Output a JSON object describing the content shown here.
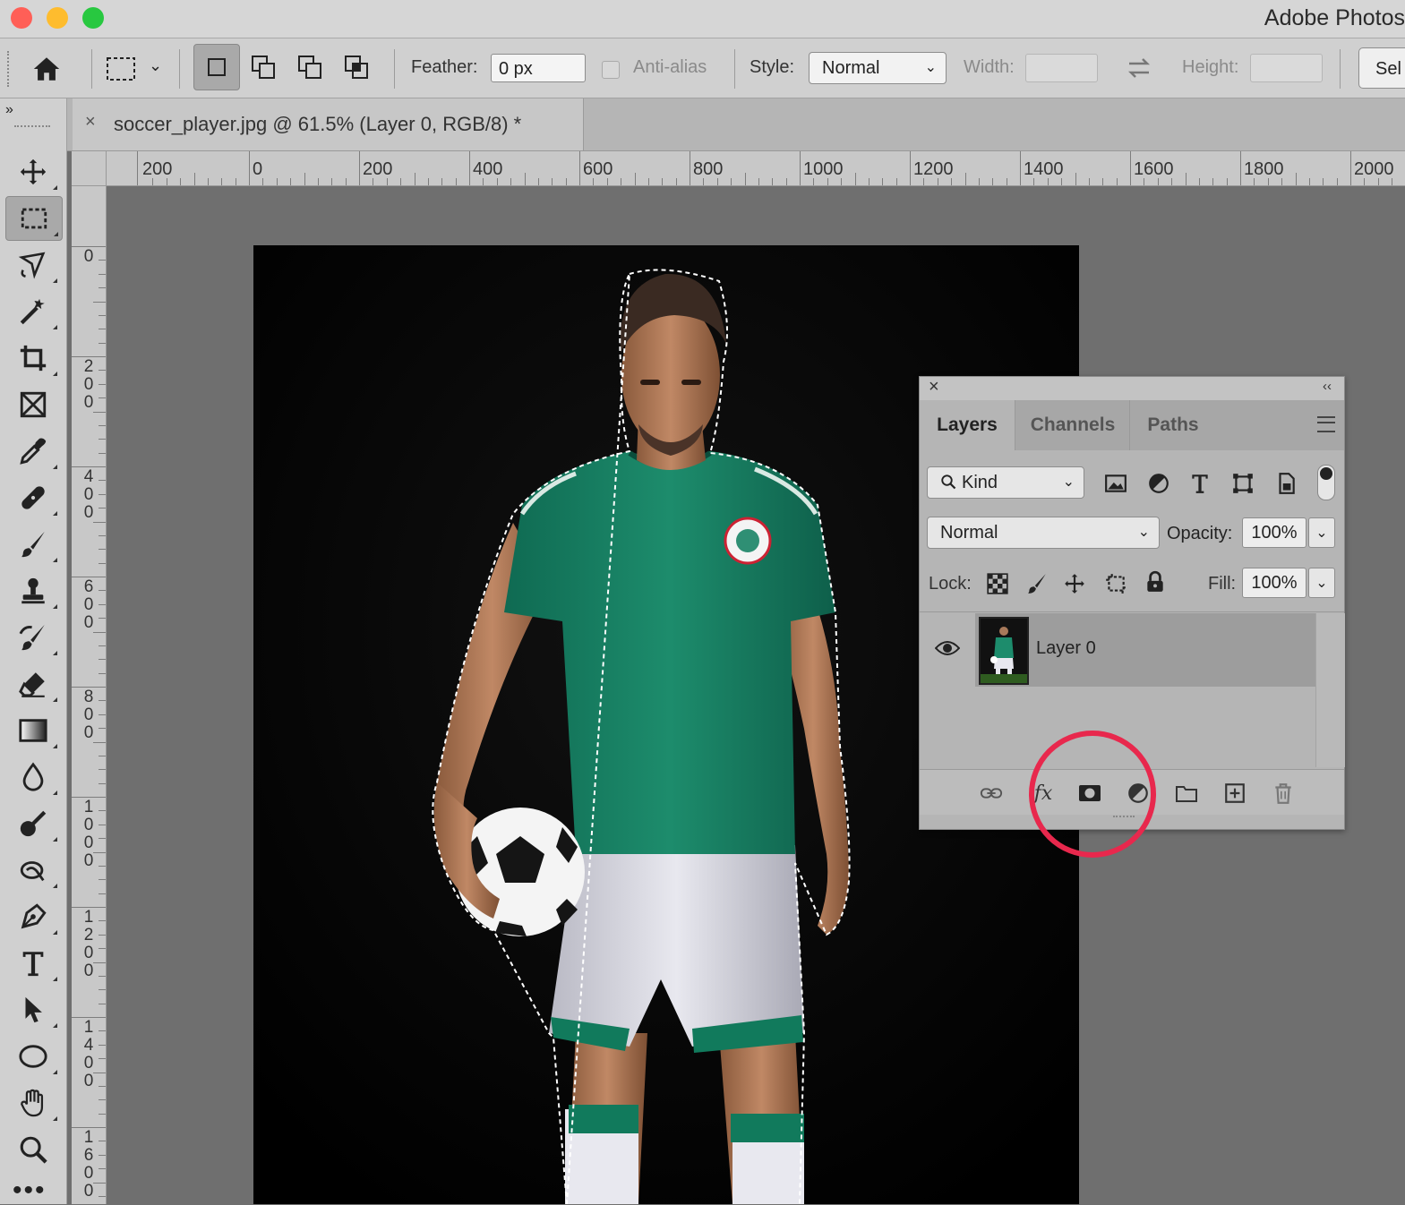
{
  "window": {
    "title": "Adobe Photos",
    "traffic_colors": {
      "close": "#ff5f57",
      "minimize": "#febc2e",
      "maximize": "#28c840"
    }
  },
  "options_bar": {
    "feather_label": "Feather:",
    "feather_value": "0 px",
    "anti_alias_label": "Anti-alias",
    "style_label": "Style:",
    "style_value": "Normal",
    "width_label": "Width:",
    "height_label": "Height:",
    "select_button_label": "Sel"
  },
  "document": {
    "tab_title": "soccer_player.jpg @ 61.5% (Layer 0, RGB/8) *"
  },
  "rulers": {
    "horizontal_labels": [
      "200",
      "0",
      "200",
      "400",
      "600",
      "800",
      "1000",
      "1200",
      "1400",
      "1600",
      "1800",
      "2000"
    ],
    "vertical_labels": [
      "0",
      "200",
      "400",
      "600",
      "800",
      "1000",
      "1200",
      "1400",
      "1600"
    ]
  },
  "layers_panel": {
    "tabs": [
      "Layers",
      "Channels",
      "Paths"
    ],
    "active_tab": "Layers",
    "filter_kind": "Kind",
    "blend_mode": "Normal",
    "opacity_label": "Opacity:",
    "opacity_value": "100%",
    "lock_label": "Lock:",
    "fill_label": "Fill:",
    "fill_value": "100%",
    "layers": [
      {
        "name": "Layer 0",
        "visible": true
      }
    ]
  },
  "highlight_color": "#e8284d"
}
